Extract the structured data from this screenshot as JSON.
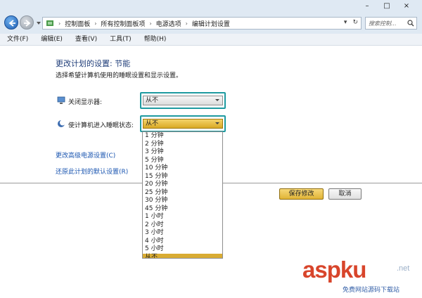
{
  "window": {
    "minimize_glyph": "–",
    "maximize_glyph": "□",
    "close_glyph": "×"
  },
  "address": {
    "crumbs": [
      "控制面板",
      "所有控制面板项",
      "电源选项",
      "编辑计划设置"
    ],
    "separator": "›",
    "dropdown_glyph": "▾",
    "refresh_glyph": "↻"
  },
  "search": {
    "placeholder": "搜索控制..."
  },
  "menu": [
    "文件(F)",
    "编辑(E)",
    "查看(V)",
    "工具(T)",
    "帮助(H)"
  ],
  "page": {
    "title": "更改计划的设置: 节能",
    "subtitle": "选择希望计算机使用的睡眠设置和显示设置。"
  },
  "display_setting": {
    "label": "关闭显示器:",
    "value": "从不"
  },
  "sleep_setting": {
    "label": "使计算机进入睡眠状态:",
    "value": "从不",
    "options": [
      "1 分钟",
      "2 分钟",
      "3 分钟",
      "5 分钟",
      "10 分钟",
      "15 分钟",
      "20 分钟",
      "25 分钟",
      "30 分钟",
      "45 分钟",
      "1 小时",
      "2 小时",
      "3 小时",
      "4 小时",
      "5 小时",
      "从不"
    ],
    "selected_index": 15
  },
  "links": {
    "advanced": "更改高级电源设置(C)",
    "restore": "还原此计划的默认设置(R)"
  },
  "buttons": {
    "save": "保存修改",
    "cancel": "取消"
  },
  "watermark": {
    "brand": "aspku",
    "tld": ".net",
    "sub": "免费网站源码下载站"
  },
  "colors": {
    "highlight_border": "#1e9aa0",
    "selected_option": "#d9ac33",
    "link": "#1a55b0",
    "watermark": "#d8452b"
  }
}
